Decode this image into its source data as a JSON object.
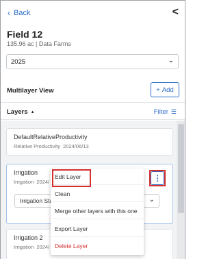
{
  "header": {
    "back_label": "Back",
    "collapse_glyph": "<"
  },
  "field": {
    "name": "Field 12",
    "summary": "135.96 ac | Data Farms"
  },
  "year_select": {
    "value": "2025"
  },
  "multilayer": {
    "title": "Multilayer View",
    "add_label": "Add",
    "add_glyph": "+"
  },
  "layers": {
    "title": "Layers",
    "sort_glyph": "▲",
    "filter_label": "Filter",
    "filter_glyph": "☰",
    "items": [
      {
        "name": "DefaultRelativeProductivity",
        "type": "Relative Productivity",
        "date": "2024/06/13"
      },
      {
        "name": "Irrigation",
        "type": "Irrigation",
        "date": "2024/",
        "select_value": "Irrigation Sta"
      },
      {
        "name": "Irrigation 2",
        "type": "Irrigation",
        "date": "2024/"
      }
    ]
  },
  "context_menu": {
    "items": [
      "Edit Layer",
      "Clean",
      "Merge other layers with this one",
      "Export Layer",
      "Delete Layer"
    ],
    "danger_color": "#d32f2f"
  },
  "colors": {
    "accent": "#2a6cc9",
    "highlight": "#d32f2f"
  }
}
